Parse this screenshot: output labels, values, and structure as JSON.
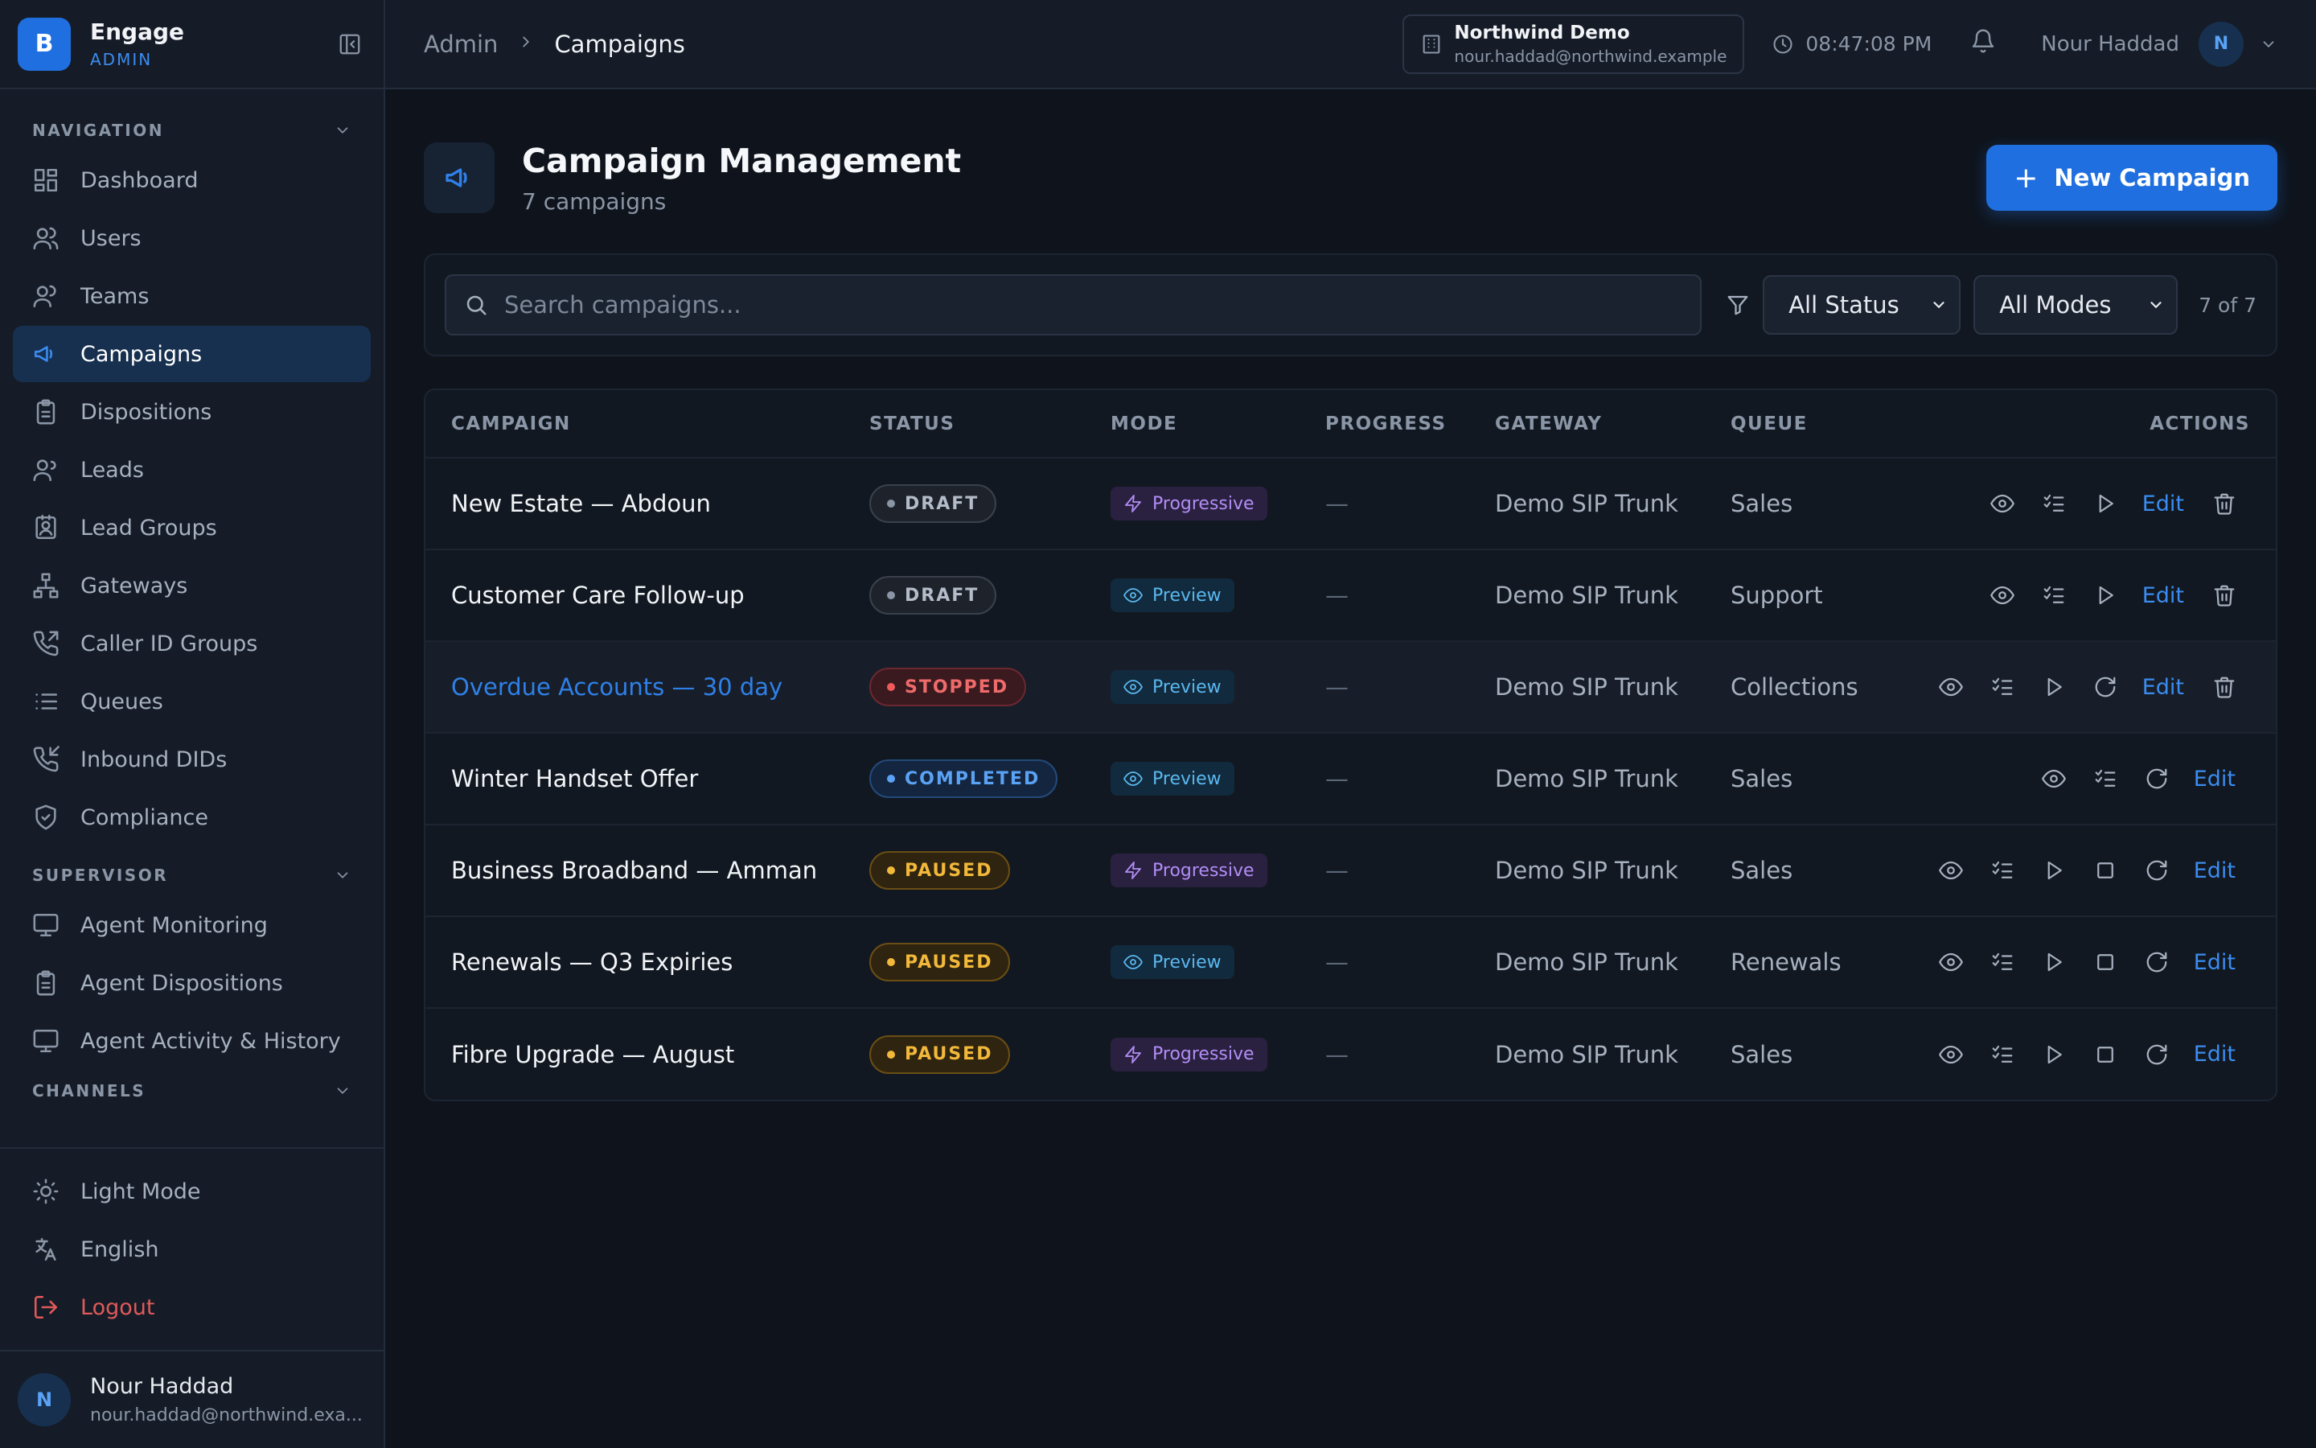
{
  "app": {
    "logo_letter": "B",
    "name": "Engage",
    "role": "ADMIN"
  },
  "sidebar": {
    "sections": [
      {
        "title": "NAVIGATION",
        "items": [
          {
            "label": "Dashboard",
            "icon": "grid-icon"
          },
          {
            "label": "Users",
            "icon": "users-icon"
          },
          {
            "label": "Teams",
            "icon": "team-icon"
          },
          {
            "label": "Campaigns",
            "icon": "megaphone-icon",
            "active": true
          },
          {
            "label": "Dispositions",
            "icon": "clipboard-icon"
          },
          {
            "label": "Leads",
            "icon": "leads-icon"
          },
          {
            "label": "Lead Groups",
            "icon": "contact-card-icon"
          },
          {
            "label": "Gateways",
            "icon": "network-icon"
          },
          {
            "label": "Caller ID Groups",
            "icon": "phone-outgoing-icon"
          },
          {
            "label": "Queues",
            "icon": "list-icon"
          },
          {
            "label": "Inbound DIDs",
            "icon": "phone-incoming-icon"
          },
          {
            "label": "Compliance",
            "icon": "shield-check-icon"
          }
        ]
      },
      {
        "title": "SUPERVISOR",
        "items": [
          {
            "label": "Agent Monitoring",
            "icon": "monitor-icon"
          },
          {
            "label": "Agent Dispositions",
            "icon": "clipboard-icon"
          },
          {
            "label": "Agent Activity & History",
            "icon": "monitor-icon"
          }
        ]
      },
      {
        "title": "CHANNELS",
        "items": []
      }
    ],
    "bottom": {
      "light_mode": "Light Mode",
      "language": "English",
      "logout": "Logout"
    },
    "user": {
      "initial": "N",
      "name": "Nour Haddad",
      "email": "nour.haddad@northwind.exa..."
    }
  },
  "topbar": {
    "breadcrumb_root": "Admin",
    "breadcrumb_current": "Campaigns",
    "tenant_name": "Northwind Demo",
    "tenant_email": "nour.haddad@northwind.example",
    "time": "08:47:08 PM",
    "user_name": "Nour Haddad",
    "user_initial": "N"
  },
  "page": {
    "title": "Campaign Management",
    "subtitle": "7 campaigns",
    "new_button": "New Campaign",
    "plus": "+"
  },
  "filters": {
    "search_placeholder": "Search campaigns...",
    "status_value": "All Status",
    "mode_value": "All Modes",
    "count": "7 of 7"
  },
  "table": {
    "columns": [
      "CAMPAIGN",
      "STATUS",
      "MODE",
      "PROGRESS",
      "GATEWAY",
      "QUEUE",
      "ACTIONS"
    ],
    "edit_label": "Edit",
    "rows": [
      {
        "name": "New Estate — Abdoun",
        "status": "DRAFT",
        "mode": "Progressive",
        "progress": "—",
        "gateway": "Demo SIP Trunk",
        "queue": "Sales"
      },
      {
        "name": "Customer Care Follow-up",
        "status": "DRAFT",
        "mode": "Preview",
        "progress": "—",
        "gateway": "Demo SIP Trunk",
        "queue": "Support"
      },
      {
        "name": "Overdue Accounts — 30 day",
        "status": "STOPPED",
        "mode": "Preview",
        "progress": "—",
        "gateway": "Demo SIP Trunk",
        "queue": "Collections"
      },
      {
        "name": "Winter Handset Offer",
        "status": "COMPLETED",
        "mode": "Preview",
        "progress": "—",
        "gateway": "Demo SIP Trunk",
        "queue": "Sales"
      },
      {
        "name": "Business Broadband — Amman",
        "status": "PAUSED",
        "mode": "Progressive",
        "progress": "—",
        "gateway": "Demo SIP Trunk",
        "queue": "Sales"
      },
      {
        "name": "Renewals — Q3 Expiries",
        "status": "PAUSED",
        "mode": "Preview",
        "progress": "—",
        "gateway": "Demo SIP Trunk",
        "queue": "Renewals"
      },
      {
        "name": "Fibre Upgrade — August",
        "status": "PAUSED",
        "mode": "Progressive",
        "progress": "—",
        "gateway": "Demo SIP Trunk",
        "queue": "Sales"
      }
    ]
  },
  "colors": {
    "accent": "#1f6fe0",
    "background": "#0f141c",
    "sidebar": "#151c27",
    "danger": "#e05a5a"
  }
}
